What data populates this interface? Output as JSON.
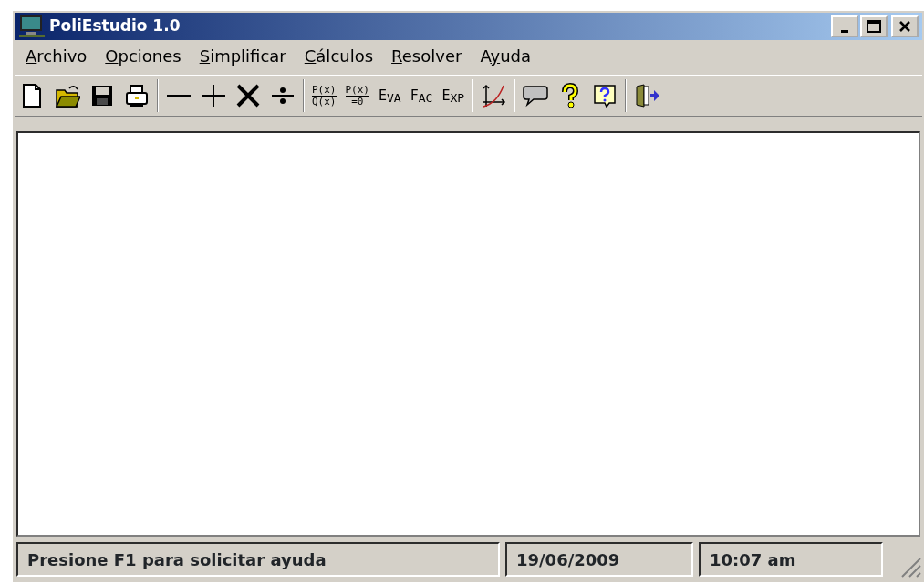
{
  "window": {
    "title": "PoliEstudio 1.0"
  },
  "menu": [
    {
      "key": "A",
      "after": "rchivo"
    },
    {
      "key": "O",
      "after": "pciones"
    },
    {
      "key": "S",
      "after": "implificar"
    },
    {
      "key": "C",
      "after": "álculos"
    },
    {
      "key": "R",
      "after": "esolver"
    },
    {
      "before": "A",
      "key": "y",
      "after": "uda"
    }
  ],
  "toolbar": [
    {
      "kind": "icon"
    },
    {
      "kind": "icon"
    },
    {
      "kind": "icon"
    },
    {
      "kind": "icon"
    },
    {
      "kind": "sep"
    },
    {
      "kind": "icon"
    },
    {
      "kind": "icon"
    },
    {
      "kind": "icon"
    },
    {
      "kind": "icon"
    },
    {
      "kind": "sep"
    },
    {
      "kind": "fraction",
      "top": "P(x)",
      "bottom": "Q(x)"
    },
    {
      "kind": "fraction",
      "top": "P(x)",
      "bottom": "=0"
    },
    {
      "kind": "label",
      "text": "E$_{VA}$"
    },
    {
      "kind": "label",
      "text": "F$_{AC}$"
    },
    {
      "kind": "label",
      "text": "E$_{XP}$"
    },
    {
      "kind": "sep"
    },
    {
      "kind": "icon"
    },
    {
      "kind": "sep"
    },
    {
      "kind": "icon"
    },
    {
      "kind": "icon"
    },
    {
      "kind": "icon"
    },
    {
      "kind": "sep"
    },
    {
      "kind": "icon"
    }
  ],
  "status_bar": [
    "Presione F1 para solicitar ayuda",
    "19/06/2009",
    "10:07 am"
  ]
}
